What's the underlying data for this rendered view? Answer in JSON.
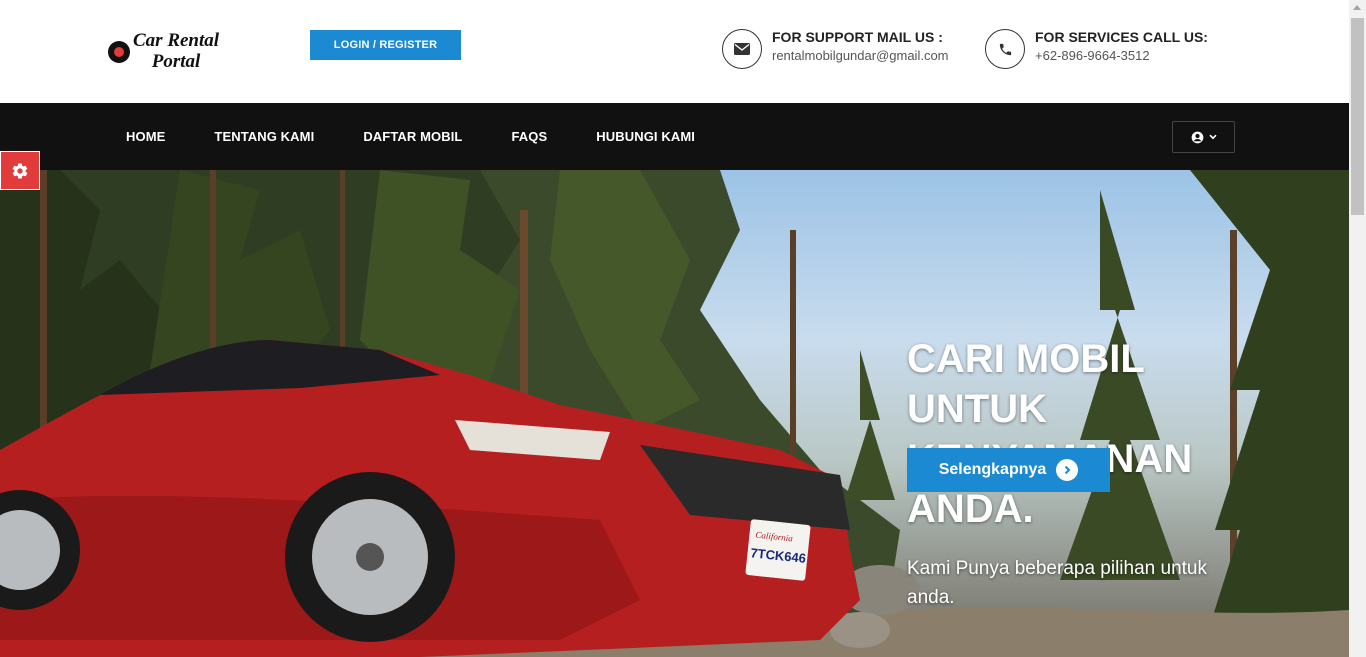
{
  "logo": {
    "line1": "Car Rental",
    "line2": "Portal"
  },
  "header": {
    "login_label": "LOGIN / REGISTER",
    "mail": {
      "label": "FOR SUPPORT MAIL US :",
      "value": "rentalmobilgundar@gmail.com",
      "icon": "envelope-icon"
    },
    "phone": {
      "label": "FOR SERVICES CALL US:",
      "value": "+62-896-9664-3512",
      "icon": "phone-icon"
    }
  },
  "nav": {
    "items": [
      {
        "label": "HOME"
      },
      {
        "label": "TENTANG KAMI"
      },
      {
        "label": "DAFTAR MOBIL"
      },
      {
        "label": "FAQS"
      },
      {
        "label": "HUBUNGI KAMI"
      }
    ],
    "user_icon": "user-circle-icon"
  },
  "hero": {
    "title": "CARI MOBIL UNTUK KENYAMANAN ANDA.",
    "subtitle": "Kami Punya beberapa pilihan untuk anda.",
    "button_label": "Selengkapnya",
    "plate_text": "7TCK646",
    "plate_state": "California"
  },
  "colors": {
    "accent": "#1c8ad2",
    "navbar": "#111111",
    "settings": "#e23b3b"
  }
}
